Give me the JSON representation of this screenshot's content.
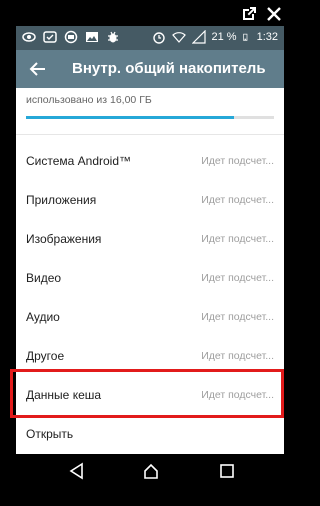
{
  "status_bar": {
    "battery": "21 %",
    "time": "1:32"
  },
  "app_bar": {
    "title": "Внутр. общий накопитель"
  },
  "storage": {
    "usage_text": "использовано из 16,00 ГБ",
    "progress_fraction": 0.84
  },
  "list": {
    "items": [
      {
        "label": "Система Android™",
        "value": "Идет подсчет..."
      },
      {
        "label": "Приложения",
        "value": "Идет подсчет..."
      },
      {
        "label": "Изображения",
        "value": "Идет подсчет..."
      },
      {
        "label": "Видео",
        "value": "Идет подсчет..."
      },
      {
        "label": "Аудио",
        "value": "Идет подсчет..."
      },
      {
        "label": "Другое",
        "value": "Идет подсчет..."
      },
      {
        "label": "Данные кеша",
        "value": "Идет подсчет..."
      },
      {
        "label": "Открыть",
        "value": ""
      }
    ]
  },
  "icons": {
    "top_external": [
      "open-in-new-icon",
      "close-icon"
    ],
    "status_left": [
      "eye-icon",
      "phone-check-icon",
      "chat-icon",
      "image-icon",
      "bug-icon"
    ],
    "status_right": [
      "alarm-icon",
      "wifi-icon",
      "signal-icon",
      "battery-icon"
    ],
    "navigation": [
      "back-icon",
      "home-icon",
      "recent-apps-icon"
    ]
  },
  "colors": {
    "status_bar": "#455a64",
    "app_bar": "#607d8b",
    "progress": "#26a8d8",
    "highlight": "#e21b1b"
  }
}
